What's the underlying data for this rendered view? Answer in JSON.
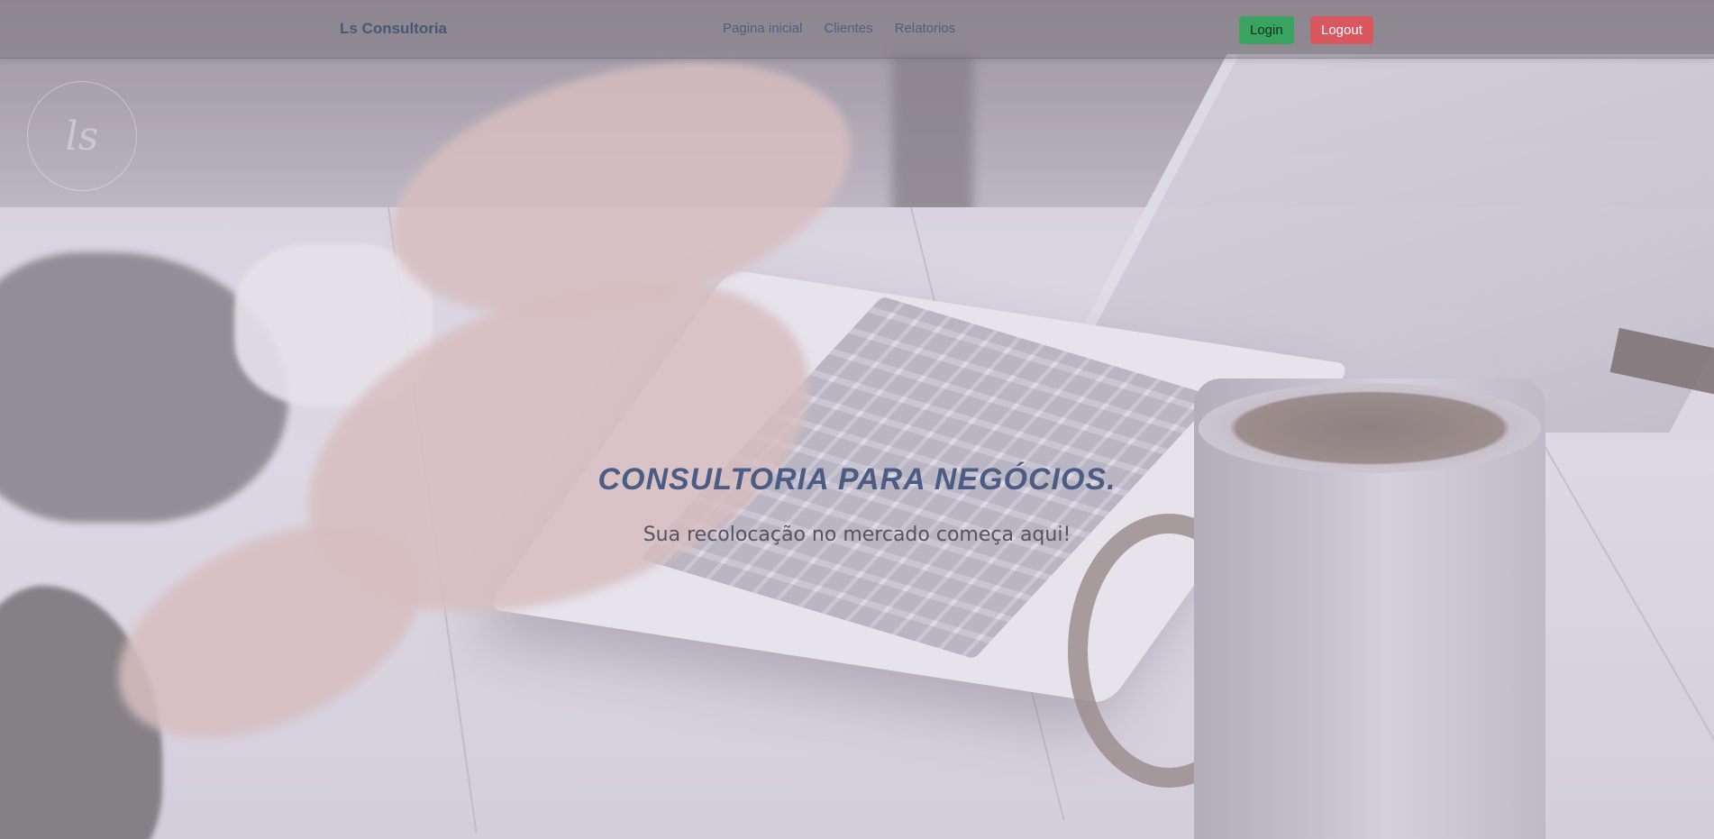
{
  "navbar": {
    "brand": "Ls Consultoria",
    "links": [
      "Pagina inicial",
      "Clientes",
      "Relatorios"
    ],
    "login_label": "Login",
    "logout_label": "Logout"
  },
  "watermark": {
    "text": "ls"
  },
  "hero": {
    "title": "CONSULTORIA PARA NEGÓCIOS.",
    "subtitle": "Sua recolocação no mercado começa aqui!"
  },
  "colors": {
    "brand_text": "#45587a",
    "login_button": "#3aa35f",
    "logout_button": "#d9575e",
    "hero_title": "#4b5d84"
  }
}
